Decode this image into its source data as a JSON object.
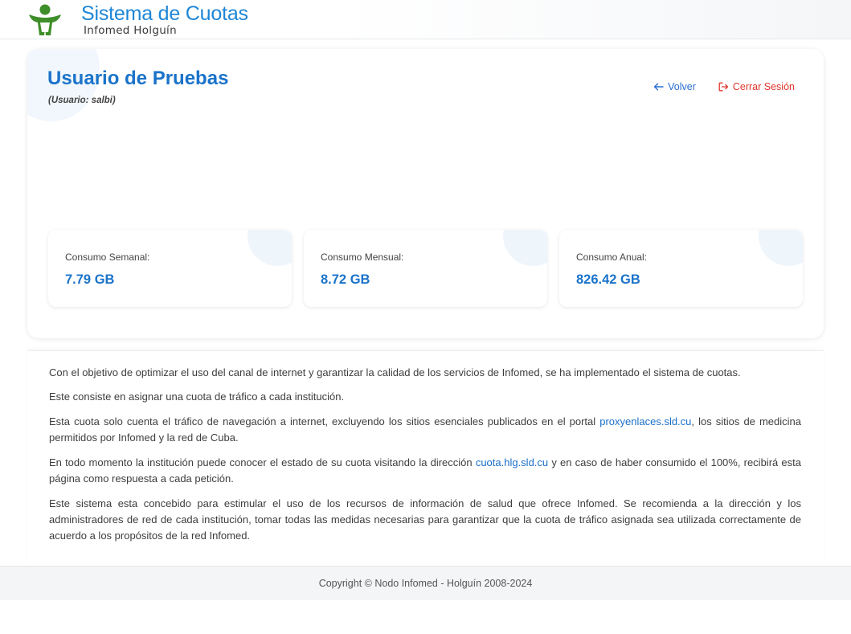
{
  "header": {
    "title": "Sistema de Cuotas",
    "subtitle": "Infomed Holguín",
    "logo_icon": "person-logo-icon",
    "logo_color": "#3e8e2a"
  },
  "user": {
    "name": "Usuario de Pruebas",
    "username_line": "(Usuario: salbi)"
  },
  "nav": {
    "back_label": "Volver",
    "back_icon": "arrow-left-icon",
    "logout_label": "Cerrar Sesión",
    "logout_icon": "sign-out-icon"
  },
  "stats": [
    {
      "label": "Consumo Semanal:",
      "value": "7.79 GB"
    },
    {
      "label": "Consumo Mensual:",
      "value": "8.72 GB"
    },
    {
      "label": "Consumo Anual:",
      "value": "826.42 GB"
    }
  ],
  "info": {
    "p1": "Con el objetivo de optimizar el uso del canal de internet y garantizar la calidad de los servicios de Infomed, se ha implementado el sistema de cuotas.",
    "p2": "Este consiste en asignar una cuota de tráfico a cada institución.",
    "p3_before": "Esta cuota solo cuenta el tráfico de navegación a internet, excluyendo los sitios esenciales publicados en el portal ",
    "p3_link": "proxyenlaces.sld.cu",
    "p3_after": ", los sitios de medicina permitidos por Infomed y la red de Cuba.",
    "p4_before": "En todo momento la institución puede conocer el estado de su cuota visitando la dirección ",
    "p4_link": "cuota.hlg.sld.cu",
    "p4_after": " y en caso de haber consumido el 100%, recibirá esta página como respuesta a cada petición.",
    "p5": "Este sistema esta concebido para estimular el uso de los recursos de información de salud que ofrece Infomed. Se recomienda a la dirección y los administradores de red de cada institución, tomar todas las medidas necesarias para garantizar que la cuota de tráfico asignada sea utilizada correctamente de acuerdo a los propósitos de la red Infomed."
  },
  "footer": {
    "copyright": "Copyright © Nodo Infomed - Holguín 2008-2024"
  },
  "colors": {
    "accent_blue": "#1a73c9",
    "logout_red": "#e0352b"
  }
}
